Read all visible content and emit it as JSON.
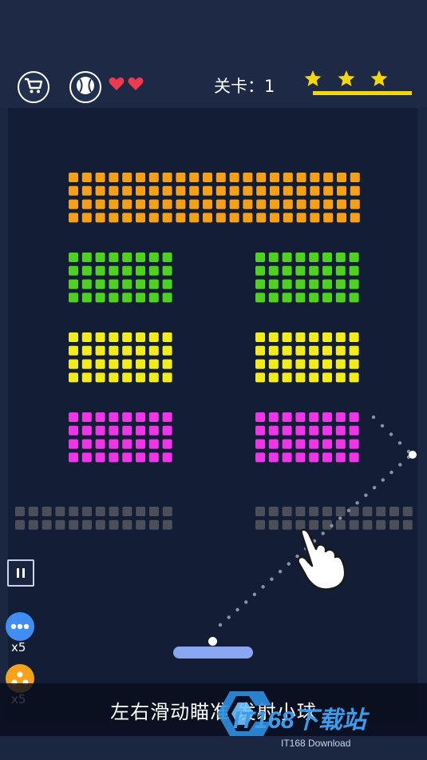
{
  "hud": {
    "lives": 2,
    "level_label": "关卡：",
    "level_value": "1",
    "stars": 3
  },
  "icons": {
    "shop": "cart-icon",
    "ball_skin": "baseball-icon",
    "pause": "pause-icon",
    "power_split": "multi-ball-icon",
    "power_explode": "explode-icon",
    "hand": "pointing-hand-icon"
  },
  "powerups": [
    {
      "name": "multi-ball",
      "count": "x5",
      "color": "#3f8ef5"
    },
    {
      "name": "explode",
      "count": "x5",
      "color": "#f5a11a"
    }
  ],
  "hint": "左右滑动瞄准 发射小球",
  "watermark": {
    "brand": "IT168下载站",
    "sub": "IT168 Download"
  },
  "colors": {
    "orange": "#f5a017",
    "green": "#4fd11f",
    "yellow": "#f1ec1a",
    "magenta": "#ee35e8",
    "gray": "#4a4f59",
    "star": "#f5d60a",
    "heart": "#ee3a4e",
    "paddle": "#8aa5f2"
  }
}
